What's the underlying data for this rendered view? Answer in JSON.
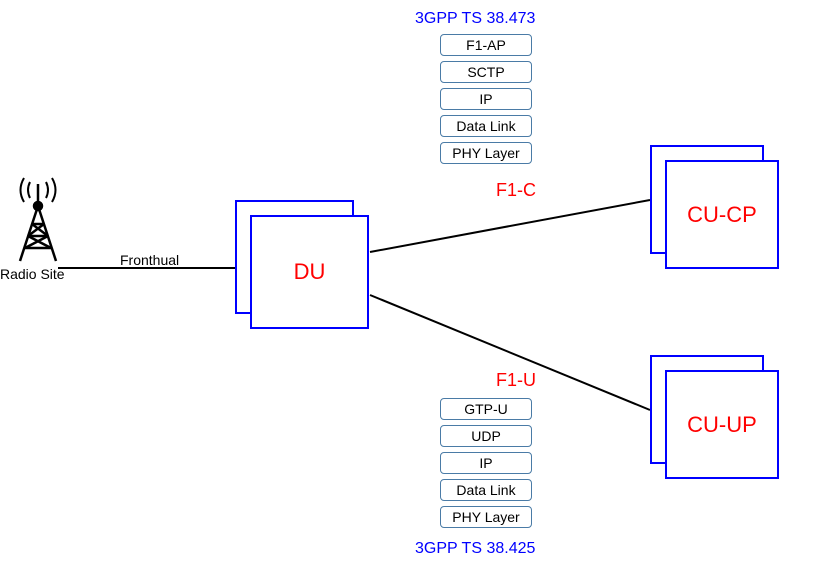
{
  "radio_site": {
    "label": "Radio Site"
  },
  "fronthaul_label": "Fronthual",
  "du": {
    "label": "DU"
  },
  "cu_cp": {
    "label": "CU-CP"
  },
  "cu_up": {
    "label": "CU-UP"
  },
  "f1c": {
    "label": "F1-C",
    "spec": "3GPP TS 38.473",
    "stack": [
      "F1-AP",
      "SCTP",
      "IP",
      "Data Link",
      "PHY Layer"
    ]
  },
  "f1u": {
    "label": "F1-U",
    "spec": "3GPP TS 38.425",
    "stack": [
      "GTP-U",
      "UDP",
      "IP",
      "Data Link",
      "PHY Layer"
    ]
  }
}
